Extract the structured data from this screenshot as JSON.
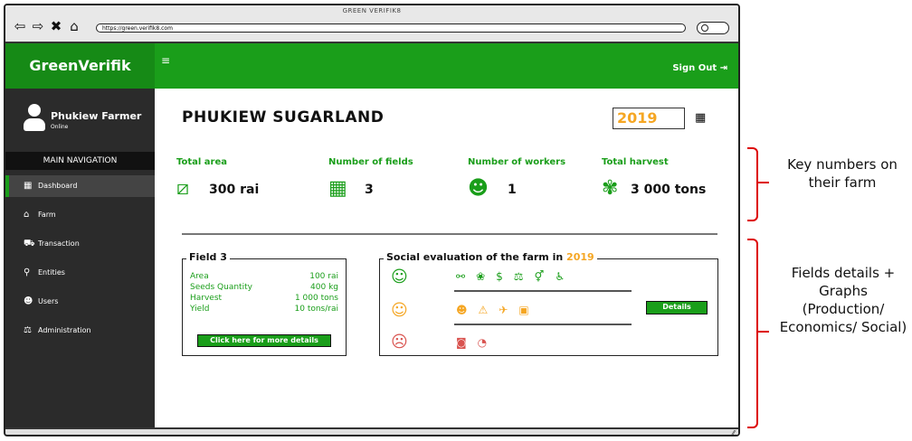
{
  "browser": {
    "title": "GREEN VERIFIK8",
    "url": "https://green.verifik8.com"
  },
  "app": {
    "brand": "GreenVerifik",
    "menu_icon": "≡",
    "sign_out": "Sign Out",
    "brand_color": "#1a9e1a"
  },
  "user": {
    "name": "Phukiew Farmer",
    "status": "Online"
  },
  "sidebar": {
    "header": "MAIN NAVIGATION",
    "items": [
      {
        "label": "Dashboard",
        "icon": "dashboard-icon",
        "active": true
      },
      {
        "label": "Farm",
        "icon": "home-icon"
      },
      {
        "label": "Transaction",
        "icon": "cart-icon"
      },
      {
        "label": "Entities",
        "icon": "pin-icon"
      },
      {
        "label": "Users",
        "icon": "users-icon"
      },
      {
        "label": "Administration",
        "icon": "admin-icon"
      }
    ]
  },
  "main": {
    "farm_title": "PHUKIEW SUGARLAND",
    "year": "2019",
    "kpis": [
      {
        "label": "Total area",
        "value": "300 rai",
        "icon": "crop-icon"
      },
      {
        "label": "Number of fields",
        "value": "3",
        "icon": "grid-icon"
      },
      {
        "label": "Number of workers",
        "value": "1",
        "icon": "workers-icon"
      },
      {
        "label": "Total harvest",
        "value": "3 000 tons",
        "icon": "sugarcane-icon"
      }
    ]
  },
  "field": {
    "title": "Field 3",
    "rows": [
      {
        "label": "Area",
        "value": "100 rai"
      },
      {
        "label": "Seeds Quantity",
        "value": "400 kg"
      },
      {
        "label": "Harvest",
        "value": "1 000 tons"
      },
      {
        "label": "Yield",
        "value": "10 tons/rai"
      }
    ],
    "more_button": "Click here for more details"
  },
  "social": {
    "title": "Social evaluation of the farm in",
    "year": "2019",
    "details_button": "Details",
    "good_icons": [
      "handshake-icon",
      "fish-icon",
      "dollar-icon",
      "scale-icon",
      "gender-icon",
      "accessibility-icon"
    ],
    "neutral_icons": [
      "family-icon",
      "warning-icon",
      "labor-icon",
      "certificate-icon"
    ],
    "bad_icons": [
      "camera-icon",
      "clock-icon"
    ],
    "colors": {
      "good": "#1a9e1a",
      "neutral": "#f5a623",
      "bad": "#d9534f"
    }
  },
  "annotations": [
    {
      "text": "Key numbers on their farm"
    },
    {
      "text": "Fields details + Graphs (Production/ Economics/ Social)"
    }
  ]
}
